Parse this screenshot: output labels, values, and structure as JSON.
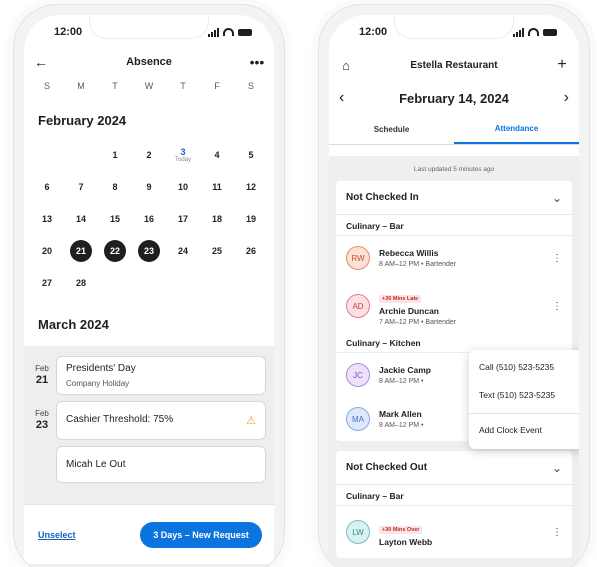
{
  "left": {
    "status_time": "12:00",
    "appbar": {
      "back_icon": "arrow-left-icon",
      "title": "Absence",
      "more_icon": "more-horizontal-icon"
    },
    "weekdays": [
      "S",
      "M",
      "T",
      "W",
      "T",
      "F",
      "S"
    ],
    "month1": "February 2024",
    "today_label": "Today",
    "weeks": [
      [
        "",
        "",
        "1",
        "2",
        "3",
        "4",
        "5"
      ],
      [
        "6",
        "7",
        "8",
        "9",
        "10",
        "11",
        "12"
      ],
      [
        "13",
        "14",
        "15",
        "16",
        "17",
        "18",
        "19"
      ],
      [
        "20",
        "21",
        "22",
        "23",
        "24",
        "25",
        "26"
      ],
      [
        "27",
        "28",
        "",
        "",
        "",
        "",
        ""
      ]
    ],
    "today_day": "3",
    "selected_days": [
      "21",
      "22",
      "23"
    ],
    "month2": "March 2024",
    "events": [
      {
        "month": "Feb",
        "day": "21",
        "title": "Presidents' Day",
        "sub": "Company Holiday"
      },
      {
        "month": "Feb",
        "day": "23",
        "title": "Cashier Threshold: 75%",
        "warn_icon": "warning-icon"
      },
      {
        "month": "",
        "day": "",
        "title": "Micah Le Out"
      }
    ],
    "footer": {
      "unselect": "Unselect",
      "request": "3 Days – New Request"
    },
    "accent": "#0b74de"
  },
  "right": {
    "status_time": "12:00",
    "appbar": {
      "home_icon": "home-icon",
      "title": "Estella Restaurant",
      "add_icon": "plus-icon"
    },
    "date": "February 14, 2024",
    "tabs": [
      "Schedule",
      "Attendance"
    ],
    "active_tab": "Attendance",
    "updated": "Last updated 5 minutes ago",
    "not_checked_in": {
      "title": "Not Checked In",
      "groups": [
        {
          "label": "Culinary – Bar",
          "people": [
            {
              "initials": "RW",
              "name": "Rebecca Willis",
              "shift": "8 AM–12 PM • Bartender",
              "badge": ""
            },
            {
              "initials": "AD",
              "name": "Archie Duncan",
              "shift": "7 AM–12 PM • Bartender",
              "badge": "+30 Mins Late"
            }
          ]
        },
        {
          "label": "Culinary – Kitchen",
          "people": [
            {
              "initials": "JC",
              "name": "Jackie Camp",
              "shift": "8 AM–12 PM •",
              "badge": ""
            },
            {
              "initials": "MA",
              "name": "Mark Allen",
              "shift": "8 AM–12 PM •",
              "badge": ""
            }
          ]
        }
      ]
    },
    "not_checked_out": {
      "title": "Not Checked Out",
      "group": "Culinary – Bar",
      "person": {
        "initials": "LW",
        "name": "Layton Webb",
        "badge": "+30 Mins Over"
      }
    },
    "popup": [
      "Call (510) 523-5235",
      "Text (510) 523-5235",
      "Add Clock Event"
    ]
  }
}
